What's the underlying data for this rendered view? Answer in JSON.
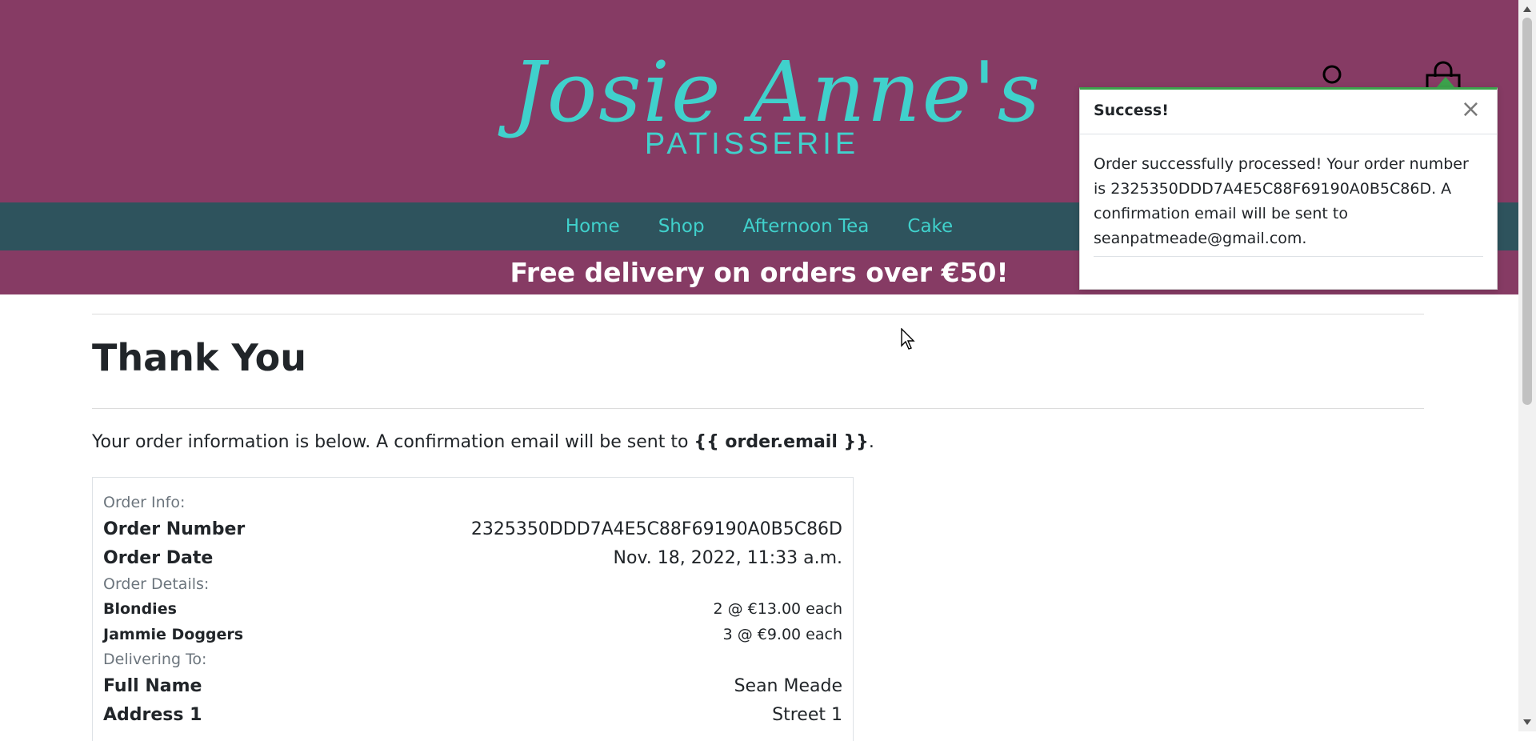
{
  "brand": {
    "logo_script": "Josie Anne's",
    "logo_sub": "PATISSERIE"
  },
  "nav": {
    "items": [
      {
        "label": "Home"
      },
      {
        "label": "Shop"
      },
      {
        "label": "Afternoon Tea"
      },
      {
        "label": "Cake"
      }
    ]
  },
  "promo": {
    "text": "Free delivery on orders over €50!"
  },
  "page": {
    "title": "Thank You",
    "intro_prefix": "Your order information is below. A confirmation email will be sent to ",
    "intro_email": "{{ order.email }}",
    "intro_suffix": "."
  },
  "order": {
    "info_label": "Order Info:",
    "number_key": "Order Number",
    "number_value": "2325350DDD7A4E5C88F69190A0B5C86D",
    "date_key": "Order Date",
    "date_value": "Nov. 18, 2022, 11:33 a.m.",
    "details_label": "Order Details:",
    "items": [
      {
        "name": "Blondies",
        "qty": "2 @ €13.00 each"
      },
      {
        "name": "Jammie Doggers",
        "qty": "3 @ €9.00 each"
      }
    ],
    "delivering_label": "Delivering To:",
    "full_name_key": "Full Name",
    "full_name_value": "Sean Meade",
    "address1_key": "Address 1",
    "address1_value": "Street 1"
  },
  "toast": {
    "title": "Success!",
    "close_glyph": "×",
    "message": "Order successfully processed! Your order number is 2325350DDD7A4E5C88F69190A0B5C86D. A confirmation email will be sent to seanpatmeade@gmail.com."
  },
  "colors": {
    "brand_plum": "#863b64",
    "nav_teal": "#2e535d",
    "accent_aqua": "#40d1cc",
    "toast_success": "#3ca24c"
  },
  "icons": {
    "account": "account-icon",
    "bag": "shopping-bag-icon",
    "close": "close-icon",
    "cursor": "mouse-cursor-icon"
  }
}
